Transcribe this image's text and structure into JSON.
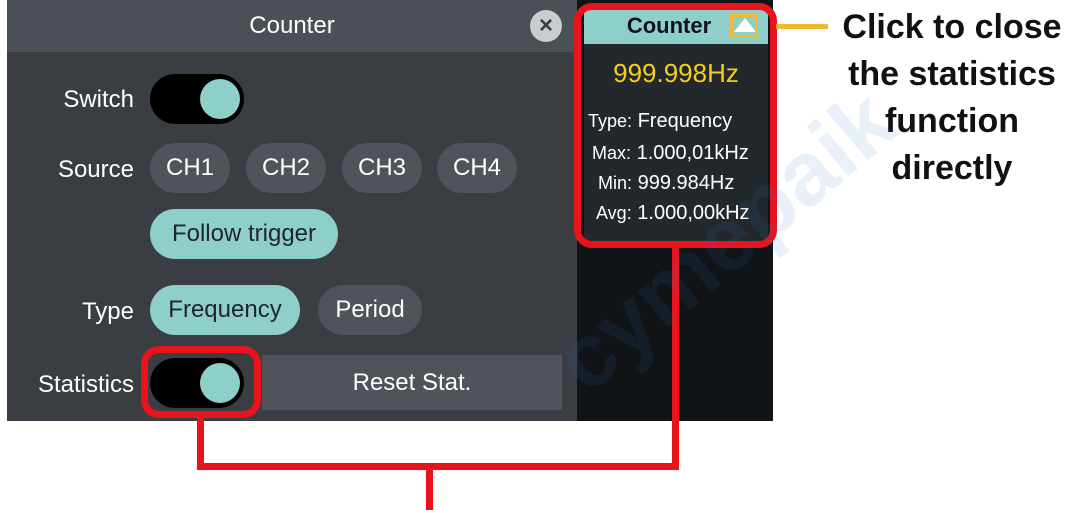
{
  "dialog": {
    "title": "Counter",
    "close_icon": "close-icon",
    "switch_label": "Switch",
    "source_label": "Source",
    "source_options": [
      "CH1",
      "CH2",
      "CH3",
      "CH4"
    ],
    "follow_trigger_label": "Follow trigger",
    "type_label": "Type",
    "type_options": [
      "Frequency",
      "Period"
    ],
    "statistics_label": "Statistics",
    "reset_label": "Reset Stat."
  },
  "stat_panel": {
    "title": "Counter",
    "value": "999.998Hz",
    "type_key": "Type:",
    "type_val": "Frequency",
    "max_key": "Max:",
    "max_val": "1.000,01kHz",
    "min_key": "Min:",
    "min_val": "999.984Hz",
    "avg_key": "Avg:",
    "avg_val": "1.000,00kHz"
  },
  "annotation": {
    "callout_text": [
      "Click to close",
      "the statistics",
      "function",
      "directly"
    ]
  },
  "watermark": "cymepaik",
  "colors": {
    "accent": "#8fcfc9",
    "highlight": "#e8131c",
    "callout": "#f4b731",
    "value": "#f6cf1a"
  }
}
